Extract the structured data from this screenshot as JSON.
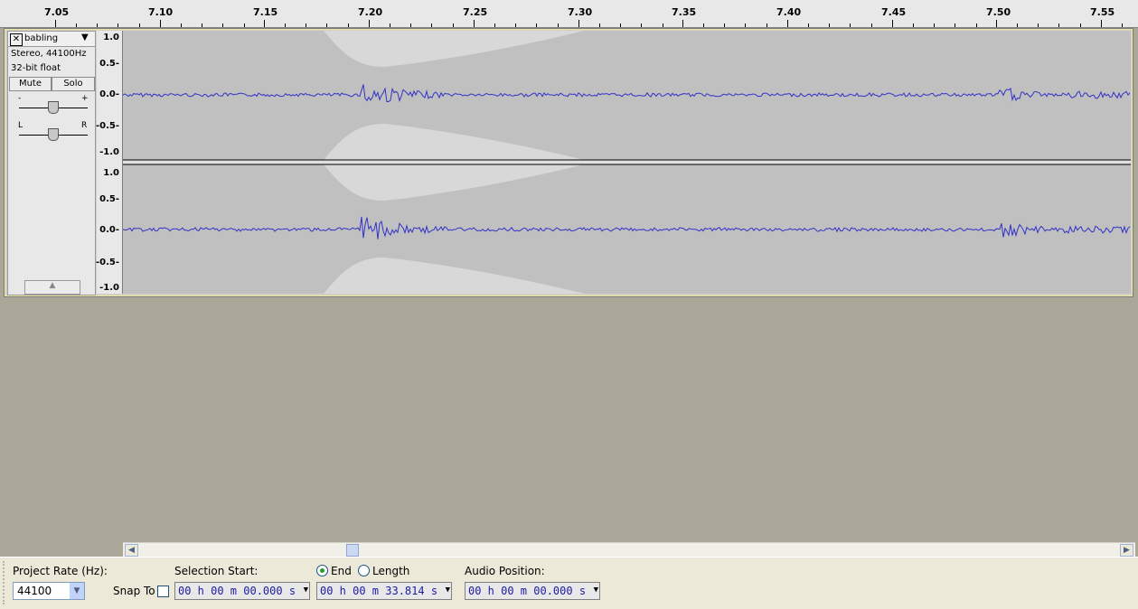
{
  "ruler": {
    "ticks": [
      "7.05",
      "7.10",
      "7.15",
      "7.20",
      "7.25",
      "7.30",
      "7.35",
      "7.40",
      "7.45",
      "7.50",
      "7.55"
    ]
  },
  "track": {
    "close_glyph": "✕",
    "name": "babling",
    "format": "Stereo, 44100Hz",
    "bit_depth": "32-bit float",
    "mute_label": "Mute",
    "solo_label": "Solo",
    "gain_minus": "-",
    "gain_plus": "+",
    "pan_left": "L",
    "pan_right": "R",
    "scale_labels": [
      "1.0",
      "0.5-",
      "0.0-",
      "-0.5-",
      "-1.0"
    ]
  },
  "selection_bar": {
    "project_rate_label": "Project Rate (Hz):",
    "project_rate_value": "44100",
    "snap_to_label": "Snap To",
    "selection_start_label": "Selection Start:",
    "selection_start_value": "00 h 00 m 00.000 s",
    "end_label": "End",
    "length_label": "Length",
    "end_value": "00 h 00 m 33.814 s",
    "audio_position_label": "Audio Position:",
    "audio_position_value": "00 h 00 m 00.000 s"
  },
  "colors": {
    "waveform": "#3232c8",
    "background": "#aaa799",
    "track_bg": "#c0c0c0",
    "envelope": "#d8d8d8"
  }
}
